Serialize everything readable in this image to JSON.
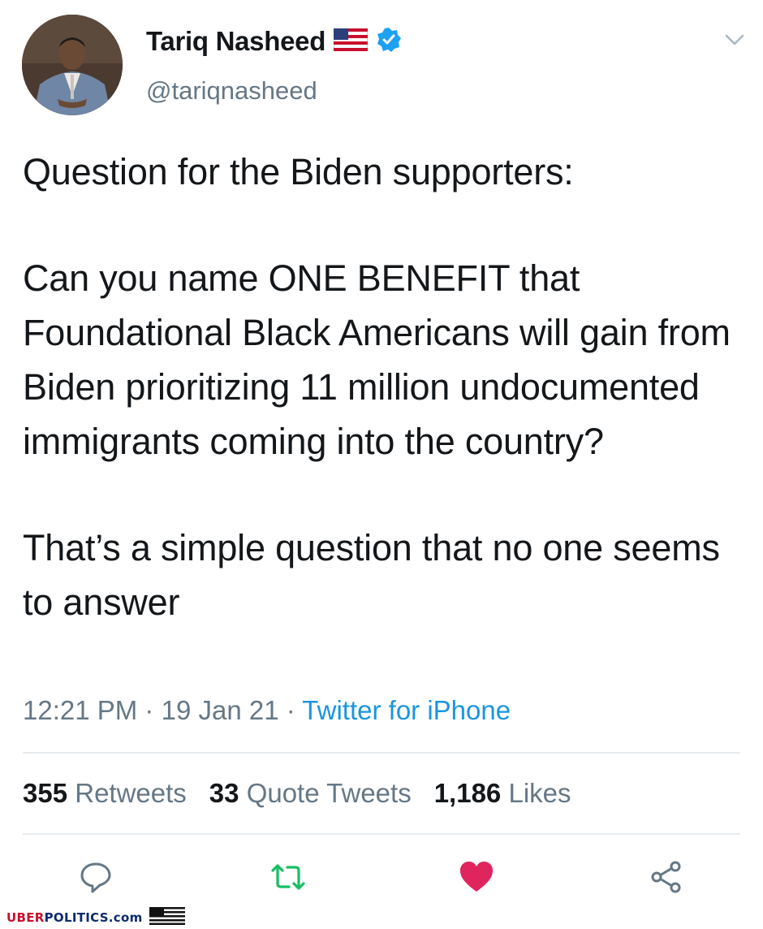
{
  "user": {
    "display_name": "Tariq Nasheed",
    "handle": "@tariqnasheed",
    "badges": [
      "us-flag-icon",
      "verified-icon"
    ]
  },
  "tweet": {
    "paragraphs": [
      "Question for the Biden supporters:",
      "Can you name ONE BENEFIT that Foundational Black Americans will gain from Biden prioritizing 11 million undocumented immigrants coming into the country?",
      "That’s a simple question that no one seems to answer"
    ],
    "time": "12:21 PM",
    "date": "19 Jan 21",
    "source": "Twitter for iPhone"
  },
  "stats": {
    "retweets_count": "355",
    "retweets_label": "Retweets",
    "quotes_count": "33",
    "quotes_label": "Quote Tweets",
    "likes_count": "1,186",
    "likes_label": "Likes"
  },
  "actions": [
    "reply-icon",
    "retweet-icon",
    "like-icon",
    "share-icon"
  ],
  "colors": {
    "text": "#14171a",
    "secondary": "#657786",
    "link": "#1b95e0",
    "retweet": "#17bf63",
    "like": "#e0245e"
  },
  "footer": {
    "brand_highlight": "UBER",
    "brand_rest": "POLITICS.com"
  }
}
